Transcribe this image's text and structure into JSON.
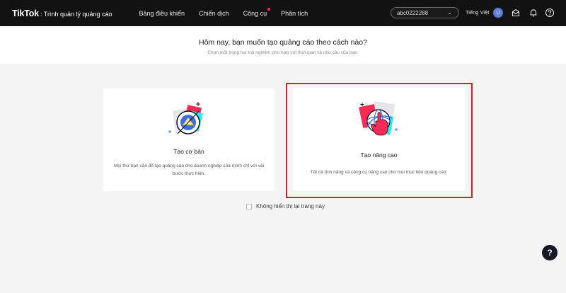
{
  "app": {
    "brand": "TikTok",
    "brand_sub": ": Trình quản lý quảng cáo"
  },
  "nav": {
    "items": [
      {
        "label": "Bảng điều khiển",
        "dot": false
      },
      {
        "label": "Chiến dịch",
        "dot": false
      },
      {
        "label": "Công cụ",
        "dot": true
      },
      {
        "label": "Phân tích",
        "dot": false
      }
    ]
  },
  "account": {
    "id": "abc0222288",
    "language": "Tiếng Việt",
    "avatar_letter": "U"
  },
  "icons": {
    "inbox": "inbox-icon",
    "bell": "bell-icon",
    "help": "question-icon"
  },
  "header": {
    "title": "Hôm nay, bạn muốn tạo quảng cáo theo cách nào?",
    "subtitle": "Chọn một trong hai trải nghiệm phù hợp với thời gian và nhu cầu của bạn."
  },
  "options": {
    "basic": {
      "title": "Tạo cơ bản",
      "description": "Mọi thứ bạn cần để tạo quảng cáo cho doanh nghiệp của mình chỉ với vài bước thực hiện."
    },
    "advanced": {
      "title": "Tạo nâng cao",
      "description": "Tất cả tính năng và công cụ nâng cao cho mọi mục tiêu quảng cáo.",
      "highlighted": true
    }
  },
  "dont_show_again": {
    "label": "Không hiển thị lại trang này",
    "checked": false
  },
  "help_button": {
    "symbol": "?"
  },
  "colors": {
    "topbar": "#121212",
    "highlight": "#d71f25",
    "brand_pink": "#fe2c55",
    "brand_cyan": "#25f4ee"
  }
}
